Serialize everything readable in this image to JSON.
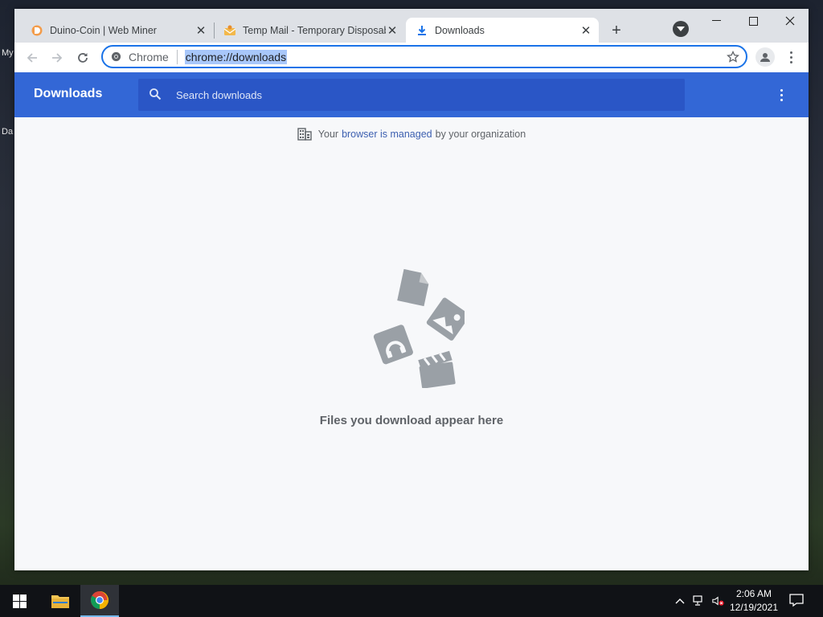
{
  "desktop": {
    "fragment_top": "My",
    "fragment_mid": "Da"
  },
  "browser": {
    "tabs": [
      {
        "title": "Duino-Coin | Web Miner",
        "icon": "duino-coin-icon"
      },
      {
        "title": "Temp Mail - Temporary Disposable",
        "icon": "temp-mail-icon"
      },
      {
        "title": "Downloads",
        "icon": "download-icon",
        "active": true
      }
    ],
    "omnibox": {
      "chip": "Chrome",
      "url": "chrome://downloads"
    }
  },
  "page": {
    "title": "Downloads",
    "search_placeholder": "Search downloads",
    "managed": {
      "prefix": "Your",
      "link": "browser is managed",
      "suffix": "by your organization"
    },
    "empty_message": "Files you download appear here"
  },
  "taskbar": {
    "time": "2:06 AM",
    "date": "12/19/2021"
  },
  "colors": {
    "header": "#3367d6",
    "search": "#2a56c6",
    "accent": "#1a73e8"
  }
}
